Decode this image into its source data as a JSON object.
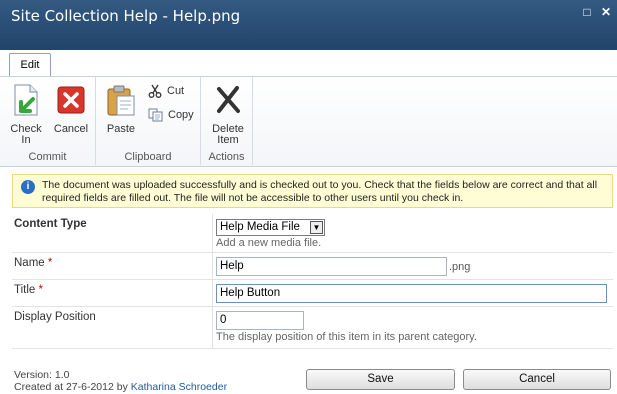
{
  "window": {
    "title": "Site Collection Help - Help.png",
    "restore_glyph": "□",
    "close_glyph": "✕"
  },
  "ribbon": {
    "tab": "Edit",
    "groups": {
      "commit": {
        "label": "Commit",
        "check_in": "Check In",
        "cancel": "Cancel"
      },
      "clipboard": {
        "label": "Clipboard",
        "paste": "Paste",
        "cut": "Cut",
        "copy": "Copy"
      },
      "actions": {
        "label": "Actions",
        "delete_item": "Delete Item"
      }
    }
  },
  "info_bar": {
    "icon": "i",
    "message": "The document was uploaded successfully and is checked out to you. Check that the fields below are correct and that all required fields are filled out. The file will not be accessible to other users until you check in."
  },
  "form": {
    "content_type": {
      "label": "Content Type",
      "value": "Help Media File",
      "description": "Add a new media file."
    },
    "name": {
      "label": "Name",
      "required_marker": "*",
      "value": "Help",
      "suffix": ".png"
    },
    "title": {
      "label": "Title",
      "required_marker": "*",
      "value": "Help Button"
    },
    "display_position": {
      "label": "Display Position",
      "value": "0",
      "description": "The display position of this item in its parent category."
    }
  },
  "footer": {
    "version": "Version: 1.0",
    "created_prefix": "Created at 27-6-2012 by",
    "created_by": "Katharina Schroeder",
    "save": "Save",
    "cancel": "Cancel"
  }
}
